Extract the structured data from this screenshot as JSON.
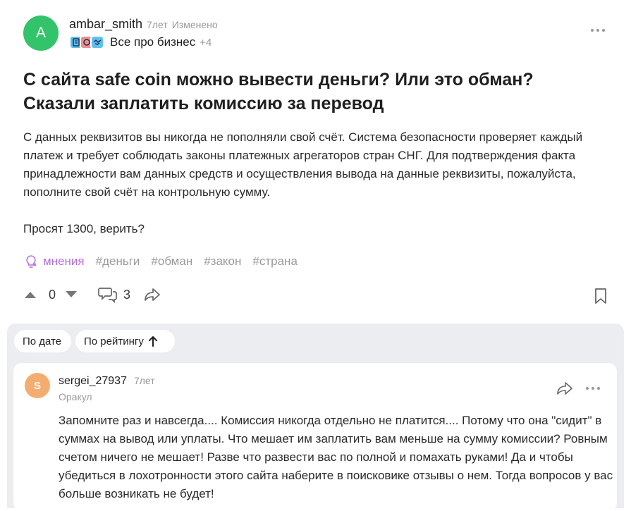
{
  "post": {
    "avatar_letter": "A",
    "author": "ambar_smith",
    "time": "7лет",
    "edited": "Изменено",
    "category": "Все про бизнес",
    "category_extra": "+4",
    "title": "С сайта safe coin можно вывести деньги? Или это обман? Сказали заплатить комиссию за перевод",
    "body_paragraph_1": "С данных реквизитов вы никогда не пополняли свой счёт. Система безопасности проверяет каждый платеж и требует соблюдать законы платежных агрегаторов стран СНГ. Для подтверждения факта принадлежности вам данных средств и осуществления вывода на данные реквизиты, пожалуйста, пополните свой счёт на контрольную сумму.",
    "body_paragraph_2": "Просят 1300, верить?",
    "topic_tag": "мнения",
    "tags": [
      "#деньги",
      "#обман",
      "#закон",
      "#страна"
    ],
    "votes": "0",
    "comments_count": "3",
    "accent_color": "#b56fe0",
    "avatar_color": "#33c36a"
  },
  "sort": {
    "by_date": "По дате",
    "by_rating": "По рейтингу",
    "by_rating_icon": "arrow-up-icon"
  },
  "comment": {
    "avatar_letter": "S",
    "author": "sergei_27937",
    "time": "7лет",
    "role": "Оракул",
    "text": "Запомните раз и навсегда.... Комиссия никогда отдельно не платится.... Потому что она \"сидит\" в суммах на вывод или уплаты. Что мешает им заплатить вам меньше на сумму комиссии? Ровным счетом ничего не мешает! Разве что развести вас по полной и помахать руками! Да и чтобы убедиться в лохотронности этого сайта наберите в поисковике отзывы о нем. Тогда вопросов у вас больше возникать не будет!",
    "avatar_color": "#f4ad70"
  }
}
